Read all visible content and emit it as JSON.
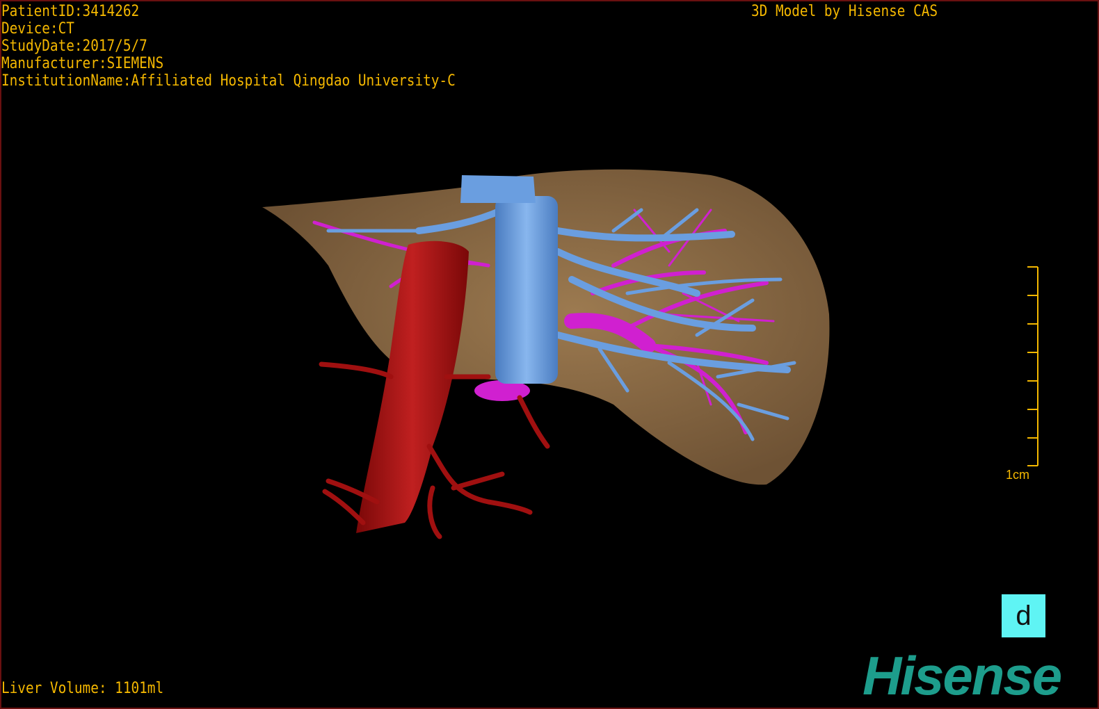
{
  "overlay": {
    "patient_id": "PatientID:3414262",
    "device": "Device:CT",
    "study_date": "StudyDate:2017/5/7",
    "manufacturer": "Manufacturer:SIEMENS",
    "institution": "InstitutionName:Affiliated Hospital Qingdao University-C",
    "brand_line": "3D Model by Hisense CAS",
    "liver_volume": "Liver Volume: 1101ml"
  },
  "scale_bar": {
    "label": "1cm",
    "ticks": 8
  },
  "orientation_cube": {
    "face_label": "d",
    "color": "#5ff4f4"
  },
  "logo": {
    "text": "Hisense",
    "color": "#1d9d8c"
  },
  "colors": {
    "overlay_text": "#f5b800",
    "liver": "#8a6a45",
    "hepatic_vein": "#6a9ee0",
    "portal_vein": "#d020d0",
    "artery": "#a01010"
  }
}
